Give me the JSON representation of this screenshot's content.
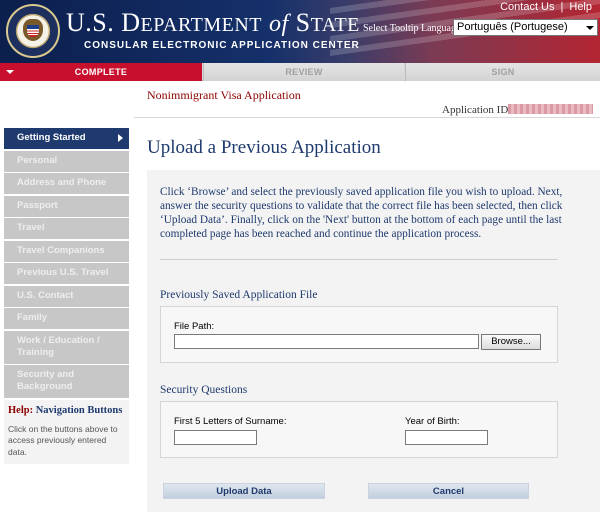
{
  "header": {
    "title_part1": "U.S. D",
    "title_caps": "EPARTMENT",
    "title_of": "of",
    "title_part2": "S",
    "title_caps2": "TATE",
    "subtitle": "CONSULAR ELECTRONIC APPLICATION CENTER",
    "links": {
      "contact": "Contact Us",
      "separator": "|",
      "help": "Help"
    },
    "tooltip_language_label": "Select Tooltip Language",
    "tooltip_language_value": "Português (Portugese)"
  },
  "progress": {
    "complete": "COMPLETE",
    "review": "REVIEW",
    "sign": "SIGN"
  },
  "subheader": {
    "application_name": "Nonimmigrant Visa Application",
    "application_id_label": "Application ID"
  },
  "sidebar": {
    "items": [
      {
        "label": "Getting Started"
      },
      {
        "label": "Personal"
      },
      {
        "label": "Address and Phone"
      },
      {
        "label": "Passport"
      },
      {
        "label": "Travel"
      },
      {
        "label": "Travel Companions"
      },
      {
        "label": "Previous U.S. Travel"
      },
      {
        "label": "U.S. Contact"
      },
      {
        "label": "Family"
      },
      {
        "label": "Work / Education / Training"
      },
      {
        "label": "Security and Background"
      }
    ],
    "help_prefix": "Help:",
    "help_title": "Navigation Buttons",
    "help_text": "Click on the buttons above to access previously entered data."
  },
  "main": {
    "title": "Upload a Previous Application",
    "instructions": "Click ‘Browse’ and select the previously saved application file you wish to upload. Next, answer the security questions to validate that the correct file has been selected, then click ‘Upload Data’. Finally, click on the 'Next' button at the bottom of each page until the last completed page has been reached and continue the application process.",
    "saved_file_section": "Previously Saved Application File",
    "file_path_label": "File Path:",
    "file_path_value": "",
    "browse_label": "Browse...",
    "security_section": "Security Questions",
    "surname_label": "First 5 Letters of Surname:",
    "surname_value": "",
    "birth_year_label": "Year of Birth:",
    "birth_year_value": "",
    "upload_label": "Upload Data",
    "cancel_label": "Cancel"
  }
}
